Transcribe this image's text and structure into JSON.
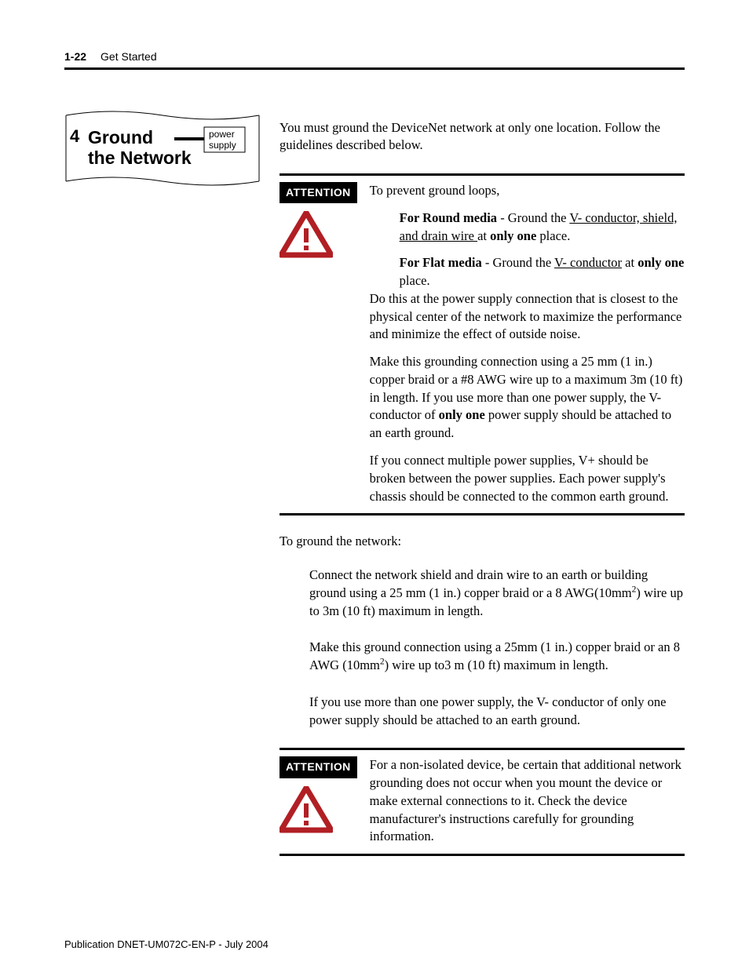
{
  "header": {
    "page_number": "1-22",
    "chapter_title": "Get Started"
  },
  "side": {
    "step_number": "4",
    "step_title_line1": "Ground",
    "step_title_line2": "the Network",
    "ps_line1": "power",
    "ps_line2": "supply"
  },
  "intro": "You must ground the DeviceNet network at only one location. Follow the guidelines described below.",
  "attention1": {
    "label": "ATTENTION",
    "lead": "To prevent ground loops,",
    "round_head": "For Round media",
    "round_mid1": " - Ground the ",
    "round_u": "V- conductor, shield, and drain wire ",
    "round_mid2": "at ",
    "round_bold": "only one",
    "round_tail": " place.",
    "flat_head": "For Flat media",
    "flat_mid1": " - Ground the ",
    "flat_u": "V- conductor",
    "flat_mid2": " at ",
    "flat_bold": "only one",
    "flat_tail": " place.",
    "p2": "Do this at the power supply connection that is closest to the physical center of the network to maximize the performance and minimize the effect of outside noise.",
    "p3a": "Make this grounding connection using a 25 mm (1 in.) copper braid or a #8 AWG wire up to a maximum 3m (10 ft) in length. If you use more than one power supply, the V- conductor of ",
    "p3b": "only one",
    "p3c": " power supply should be attached to an earth ground.",
    "p4": "If you connect multiple power supplies, V+ should be broken between the power supplies. Each power supply's chassis should be connected to the common earth ground."
  },
  "to_ground": "To ground the network:",
  "step1a": "Connect the network shield and drain wire to an earth or building ground using a 25 mm (1 in.) copper braid or a 8 AWG(10mm",
  "step1b": ") wire up to 3m (10 ft) maximum in length.",
  "step2a": "Make this ground connection using a 25mm (1 in.) copper braid or an 8 AWG (10mm",
  "step2b": ") wire up to3 m (10 ft) maximum in length.",
  "step3": "If you use more than one power supply, the V- conductor of only one power supply should be attached to an earth ground.",
  "sup2": "2",
  "attention2": {
    "label": "ATTENTION",
    "body": "For a non-isolated device, be certain that additional network grounding does not occur when you mount the device or make external connections to it. Check the device manufacturer's instructions carefully for grounding information."
  },
  "footer": "Publication DNET-UM072C-EN-P - July 2004"
}
